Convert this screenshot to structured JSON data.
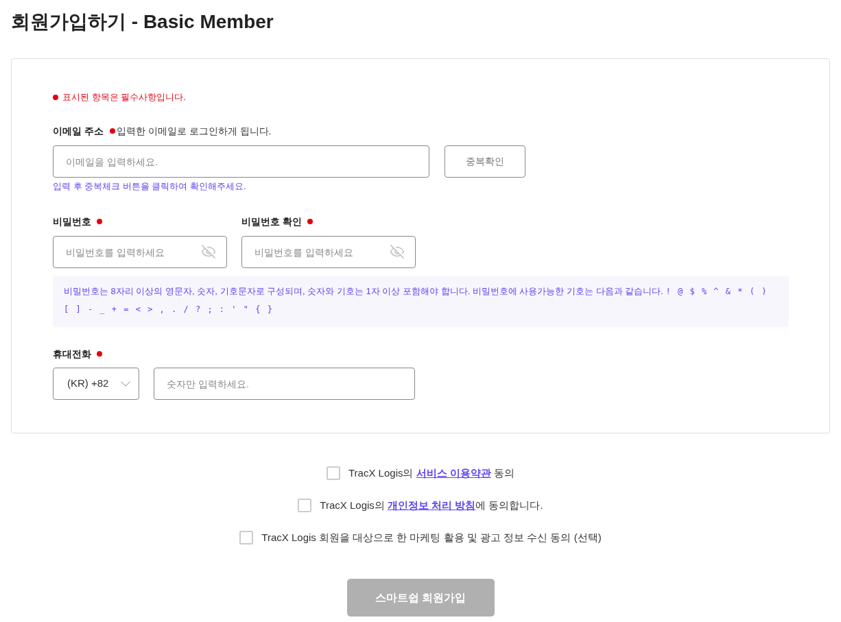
{
  "page_title": "회원가입하기 - Basic Member",
  "form": {
    "required_note": "표시된 항목은 필수사항입니다.",
    "email": {
      "label": "이메일 주소",
      "required": true,
      "hint": "입력한 이메일로 로그인하게 됩니다.",
      "placeholder": "이메일을 입력하세요.",
      "check_button": "중복확인",
      "help": "입력 후 중복체크 버튼을 클릭하여 확인해주세요."
    },
    "passwords": [
      {
        "label": "비밀번호",
        "required": true,
        "placeholder": "비밀번호를 입력하세요"
      },
      {
        "label": "비밀번호 확인",
        "required": true,
        "placeholder": "비밀번호를 입력하세요"
      }
    ],
    "password_rule": {
      "text": "비밀번호는 8자리 이상의 영문자, 숫자, 기호문자로 구성되며, 숫자와 기호는 1자 이상 포함해야 합니다. 비밀번호에 사용가능한 기호는 다음과 같습니다.",
      "symbols": "! @ $ % ^ & * ( ) [ ] - _ + = < > , . / ? ; : ' \" { }"
    },
    "phone": {
      "label": "휴대전화",
      "required": true,
      "country_code": "(KR) +82",
      "placeholder": "숫자만 입력하세요."
    }
  },
  "agreements": [
    {
      "checked": false,
      "text_before": "TracX Logis의 ",
      "link": "서비스 이용약관",
      "text_after": " 동의"
    },
    {
      "checked": false,
      "text_before": "TracX Logis의 ",
      "link": "개인정보 처리 방침",
      "text_after": "에 동의합니다."
    },
    {
      "checked": false,
      "text_before": "TracX Logis 회원을 대상으로 한 마케팅 활용 및 광고 정보 수신 동의 (선택)"
    }
  ],
  "submit_button": {
    "label": "스마트쉽 회원가입",
    "disabled": true
  }
}
